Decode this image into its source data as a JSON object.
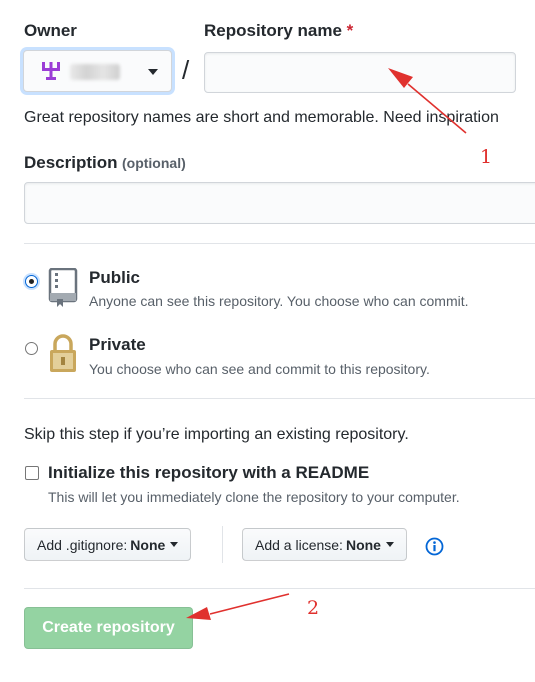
{
  "owner": {
    "label": "Owner"
  },
  "repo": {
    "label": "Repository name",
    "required_mark": "*",
    "value": ""
  },
  "hint": "Great repository names are short and memorable. Need inspiration",
  "description": {
    "label": "Description",
    "optional": "(optional)",
    "value": ""
  },
  "visibility": {
    "public": {
      "title": "Public",
      "desc": "Anyone can see this repository. You choose who can commit.",
      "checked": true
    },
    "private": {
      "title": "Private",
      "desc": "You choose who can see and commit to this repository.",
      "checked": false
    }
  },
  "skip_text": "Skip this step if you’re importing an existing repository.",
  "readme": {
    "label": "Initialize this repository with a README",
    "desc": "This will let you immediately clone the repository to your computer.",
    "checked": false
  },
  "gitignore": {
    "prefix": "Add .gitignore:",
    "value": "None"
  },
  "license": {
    "prefix": "Add a license:",
    "value": "None"
  },
  "create_label": "Create repository",
  "annotations": [
    "1",
    "2"
  ],
  "colors": {
    "primary_disabled": "#94d3a2",
    "link_blue": "#0366d6",
    "required_red": "#cb2431",
    "annotation_red": "#e0312e",
    "owner_avatar_purple": "#9b3dd6",
    "lock_gold": "#c9a75c"
  },
  "icons": {
    "owner": "owner-avatar-icon",
    "public": "book-repo-icon",
    "private": "lock-icon",
    "info": "info-icon"
  }
}
